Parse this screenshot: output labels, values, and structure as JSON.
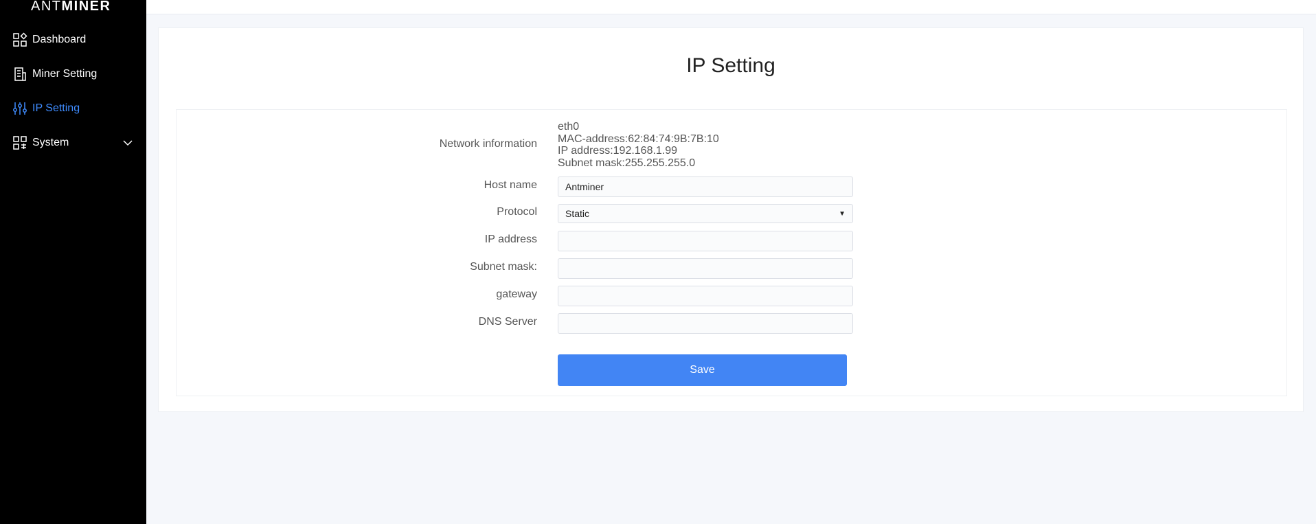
{
  "brand": {
    "light": "ANT",
    "bold": "MINER"
  },
  "sidebar": {
    "items": [
      {
        "label": "Dashboard",
        "icon": "dashboard-icon"
      },
      {
        "label": "Miner Setting",
        "icon": "miner-setting-icon"
      },
      {
        "label": "IP Setting",
        "icon": "sliders-icon",
        "active": true
      },
      {
        "label": "System",
        "icon": "system-icon"
      }
    ]
  },
  "page": {
    "title": "IP Setting"
  },
  "form": {
    "network_info": {
      "label": "Network information",
      "interface": "eth0",
      "mac": "MAC-address:62:84:74:9B:7B:10",
      "ip": "IP address:192.168.1.99",
      "subnet": "Subnet mask:255.255.255.0"
    },
    "host_name": {
      "label": "Host name",
      "value": "Antminer"
    },
    "protocol": {
      "label": "Protocol",
      "value": "Static"
    },
    "ip_address": {
      "label": "IP address",
      "value": ""
    },
    "subnet_mask": {
      "label": "Subnet mask:",
      "value": ""
    },
    "gateway": {
      "label": "gateway",
      "value": ""
    },
    "dns_server": {
      "label": "DNS Server",
      "value": ""
    },
    "save_label": "Save"
  },
  "colors": {
    "accent": "#4285f4",
    "active_nav": "#3f8cff",
    "sidebar_bg": "#000000"
  }
}
